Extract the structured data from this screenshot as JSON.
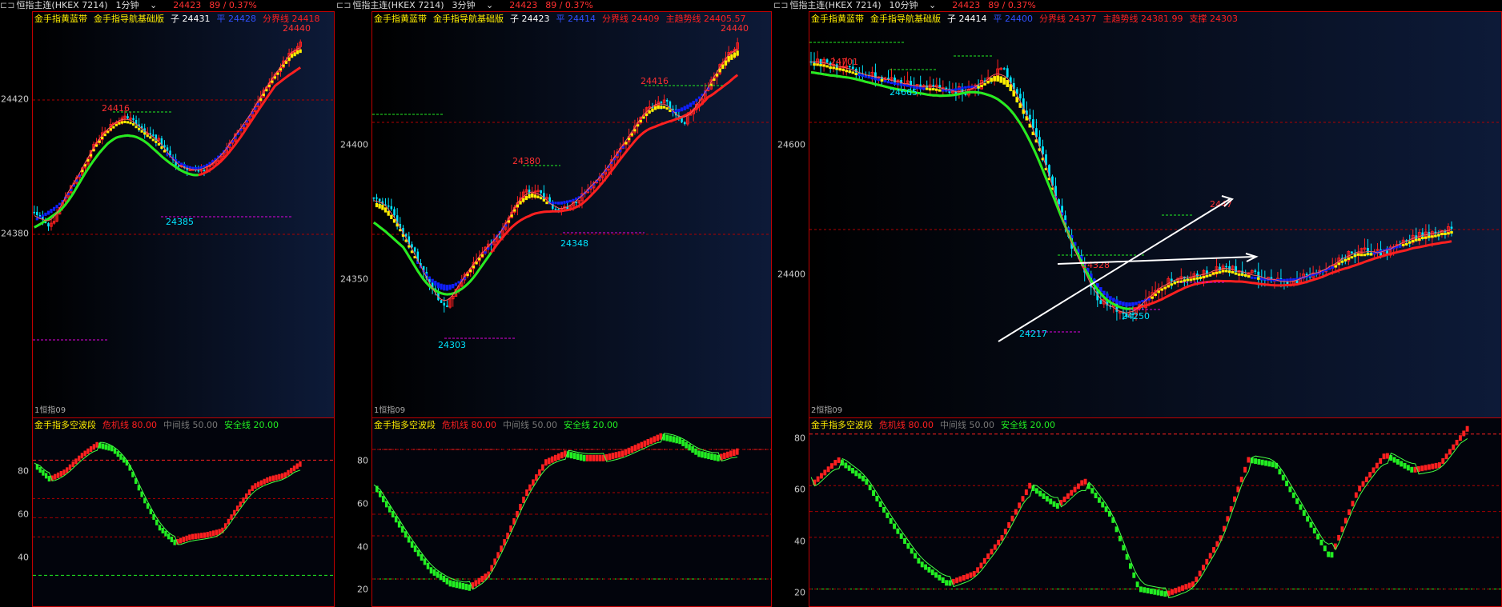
{
  "colors": {
    "red": "#ff2020",
    "green": "#22ee22",
    "yellow": "#ffee00",
    "cyan": "#00e5ff",
    "blue": "#1020ff",
    "white": "#ffffff",
    "magenta": "#e000e0",
    "grid": "#b00000"
  },
  "panels": [
    {
      "symbol": "恒指主连(HKEX 7214)",
      "period": "1分钟",
      "price": "24423",
      "change": "89 / 0.37%",
      "indicators": [
        {
          "t": "金手指黄蓝带",
          "c": "#ffee00"
        },
        {
          "t": "金手指导航基础版",
          "c": "#ffee00"
        },
        {
          "t": "子 24431",
          "c": "#ffffff"
        },
        {
          "t": "平 24428",
          "c": "#3050ff"
        },
        {
          "t": "分界线 24418",
          "c": "#ff2020"
        }
      ],
      "yticks": [
        "24420",
        "24380"
      ],
      "annotations": [
        {
          "t": "24440",
          "c": "#ff3030"
        },
        {
          "t": "24416",
          "c": "#ff3030"
        },
        {
          "t": "24385",
          "c": "#00e5ff"
        }
      ],
      "sub_label": "1恒指09",
      "osc_title": [
        {
          "t": "金手指多空波段",
          "c": "#ffee00"
        },
        {
          "t": "危机线 80.00",
          "c": "#ff2020"
        },
        {
          "t": "中间线 50.00",
          "c": "#777777"
        },
        {
          "t": "安全线 20.00",
          "c": "#22ee22"
        }
      ],
      "osc_yticks": [
        "80",
        "60",
        "40"
      ]
    },
    {
      "symbol": "恒指主连(HKEX 7214)",
      "period": "3分钟",
      "price": "24423",
      "change": "89 / 0.37%",
      "indicators": [
        {
          "t": "金手指黄蓝带",
          "c": "#ffee00"
        },
        {
          "t": "金手指导航基础版",
          "c": "#ffee00"
        },
        {
          "t": "子 24423",
          "c": "#ffffff"
        },
        {
          "t": "平 24414",
          "c": "#3050ff"
        },
        {
          "t": "分界线 24409",
          "c": "#ff2020"
        },
        {
          "t": "主趋势线 24405.57",
          "c": "#ff2020"
        }
      ],
      "yticks": [
        "24400",
        "24350"
      ],
      "annotations": [
        {
          "t": "24440",
          "c": "#ff3030"
        },
        {
          "t": "24416",
          "c": "#ff3030"
        },
        {
          "t": "24380",
          "c": "#ff3030"
        },
        {
          "t": "24348",
          "c": "#00e5ff"
        },
        {
          "t": "24303",
          "c": "#00e5ff"
        }
      ],
      "sub_label": "1恒指09",
      "osc_title": [
        {
          "t": "金手指多空波段",
          "c": "#ffee00"
        },
        {
          "t": "危机线 80.00",
          "c": "#ff2020"
        },
        {
          "t": "中间线 50.00",
          "c": "#777777"
        },
        {
          "t": "安全线 20.00",
          "c": "#22ee22"
        }
      ],
      "osc_yticks": [
        "80",
        "60",
        "40",
        "20"
      ]
    },
    {
      "symbol": "恒指主连(HKEX 7214)",
      "period": "10分钟",
      "price": "24423",
      "change": "89 / 0.37%",
      "indicators": [
        {
          "t": "金手指黄蓝带",
          "c": "#ffee00"
        },
        {
          "t": "金手指导航基础版",
          "c": "#ffee00"
        },
        {
          "t": "子 24414",
          "c": "#ffffff"
        },
        {
          "t": "平 24400",
          "c": "#3050ff"
        },
        {
          "t": "分界线 24377",
          "c": "#ff2020"
        },
        {
          "t": "主趋势线 24381.99",
          "c": "#ff2020"
        },
        {
          "t": "支撑 24303",
          "c": "#ff2020"
        }
      ],
      "yticks": [
        "24600",
        "24400"
      ],
      "annotations": [
        {
          "t": "24701",
          "c": "#ff3030"
        },
        {
          "t": "24665",
          "c": "#00e5ff"
        },
        {
          "t": "24328",
          "c": "#ff3030"
        },
        {
          "t": "24250",
          "c": "#00e5ff"
        },
        {
          "t": "24217",
          "c": "#00e5ff"
        },
        {
          "t": "2447",
          "c": "#ff3030"
        }
      ],
      "sub_label": "2恒指09",
      "osc_title": [
        {
          "t": "金手指多空波段",
          "c": "#ffee00"
        },
        {
          "t": "危机线 80.00",
          "c": "#ff2020"
        },
        {
          "t": "中间线 50.00",
          "c": "#777777"
        },
        {
          "t": "安全线 20.00",
          "c": "#22ee22"
        }
      ],
      "osc_yticks": [
        "80",
        "60",
        "40",
        "20"
      ]
    }
  ]
}
